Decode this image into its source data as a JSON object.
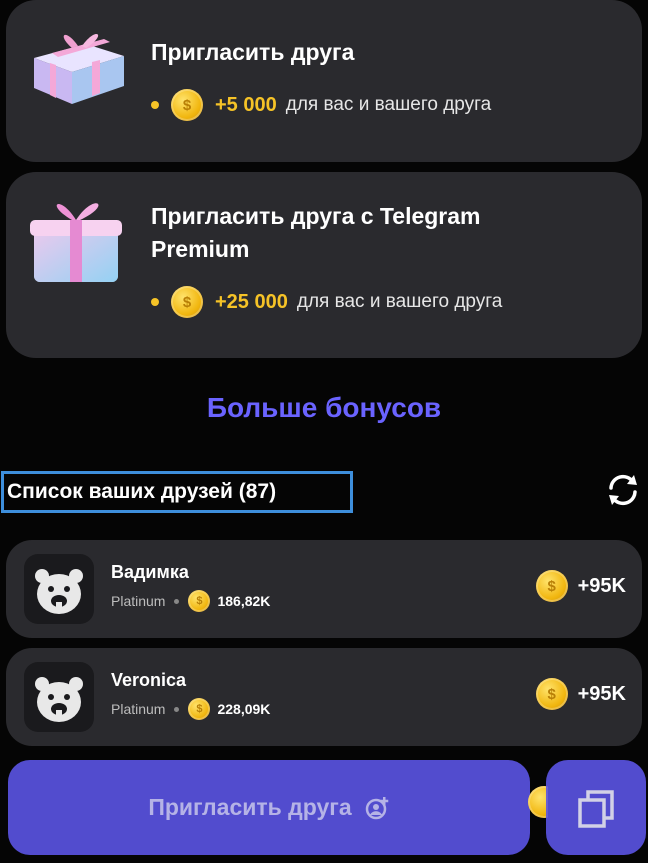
{
  "cards": [
    {
      "title": "Пригласить друга",
      "amount": "+5 000",
      "description": "для вас и вашего друга"
    },
    {
      "title_line1": "Пригласить друга с Telegram",
      "title_line2": "Premium",
      "amount": "+25 000",
      "description": "для вас и вашего друга"
    }
  ],
  "more_bonuses": "Больше бонусов",
  "friends": {
    "title": "Список ваших друзей (87)",
    "items": [
      {
        "name": "Вадимка",
        "league": "Platinum",
        "balance": "186,82K",
        "bonus": "+95K"
      },
      {
        "name": "Veronica",
        "league": "Platinum",
        "balance": "228,09K",
        "bonus": "+95K"
      }
    ]
  },
  "invite_button": {
    "label": "Пригласить друга"
  },
  "icons": {
    "gift": "gift-box-icon",
    "coin": "coin-icon",
    "refresh": "refresh-icon",
    "avatar": "hamster-avatar-icon",
    "invite": "add-user-icon",
    "copy": "copy-icon"
  },
  "colors": {
    "accent": "#5b54e4",
    "link": "#6a63ff",
    "coin": "#f6c327",
    "card": "#2a2a2e",
    "highlight": "#3e8fdc"
  }
}
